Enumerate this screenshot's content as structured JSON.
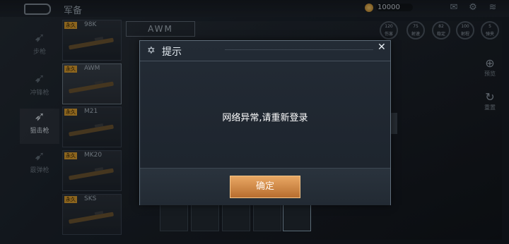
{
  "topbar": {
    "title": "军备",
    "currency": "10000",
    "icons": [
      "mail-icon",
      "gear-icon",
      "wifi-icon"
    ]
  },
  "rail": {
    "items": [
      {
        "label": "步枪",
        "icon": "rifle-icon"
      },
      {
        "label": "冲锋枪",
        "icon": "smg-icon"
      },
      {
        "label": "狙击枪",
        "icon": "sniper-icon"
      },
      {
        "label": "霰弹枪",
        "icon": "shotgun-icon"
      }
    ]
  },
  "weapons": [
    {
      "tag": "永久",
      "name": "98K"
    },
    {
      "tag": "永久",
      "name": "AWM"
    },
    {
      "tag": "永久",
      "name": "M21"
    },
    {
      "tag": "永久",
      "name": "MK20"
    },
    {
      "tag": "永久",
      "name": "SKS"
    }
  ],
  "main": {
    "weapon_title": "AWM",
    "stats": [
      {
        "value": "120",
        "label": "伤害"
      },
      {
        "value": "75",
        "label": "射速"
      },
      {
        "value": "82",
        "label": "稳定"
      },
      {
        "value": "100",
        "label": "射程"
      },
      {
        "value": "5",
        "label": "弹夹"
      }
    ],
    "side_buttons": [
      {
        "label": "预览",
        "icon": "zoom-icon"
      },
      {
        "label": "重置",
        "icon": "reset-icon"
      }
    ]
  },
  "dialog": {
    "title": "提示",
    "message": "网络异常,请重新登录",
    "ok_label": "确定"
  }
}
